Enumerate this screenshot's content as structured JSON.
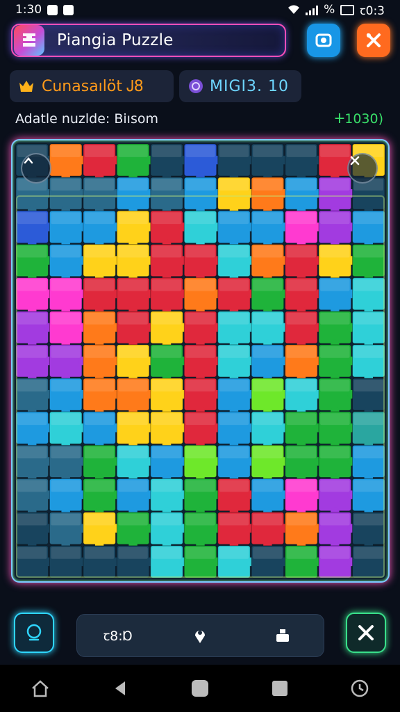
{
  "status": {
    "time": "1:30",
    "right_text": "%",
    "clock_right": "ꞇ0:3"
  },
  "header": {
    "title": "Piangia Puzzle"
  },
  "stats": {
    "score_label": "Cunasaılöt Ꭻ8",
    "level_label": "MIGI3. 10"
  },
  "info": {
    "subtitle": "Adatle nuzlde: Biısom",
    "counter": "ⵜ1030)"
  },
  "toolbar": {
    "tool1_label": "ꞇ8:Ɒ"
  },
  "colors": {
    "accent_pink": "#ff4fb8",
    "accent_cyan": "#2fd6ff",
    "accent_green": "#39e08a",
    "score_orange": "#ff9a1a",
    "level_blue": "#6ed6ff"
  },
  "puzzle": {
    "cols": 11,
    "rows": 13,
    "palette": {
      "R": "#e0283c",
      "O": "#ff7a1a",
      "Y": "#ffd21a",
      "G": "#1fb33a",
      "L": "#6ee82a",
      "C": "#2fd0d8",
      "B": "#1e9ae0",
      "N": "#2c5bd8",
      "P": "#a23be0",
      "M": "#ff3ad0",
      "K": "#2a6a8a",
      "D": "#18445e",
      "T": "#2aa6a0"
    },
    "grid": [
      "DORGDNDDDRY",
      "KKKBKBYOBPD",
      "NBBYRCBBMPB",
      "GBYYRRCORYG",
      "MMRRRORGRBC",
      "PMORYRCCRGC",
      "PPOYGRCBOGC",
      "KBOOYRBLCGD",
      "BCBYYRBCGGT",
      "KKGCBLBLGGB",
      "KBGBCGRBMPB",
      "DKYGCGRROPD",
      "DDDDCGCDGPD"
    ]
  }
}
